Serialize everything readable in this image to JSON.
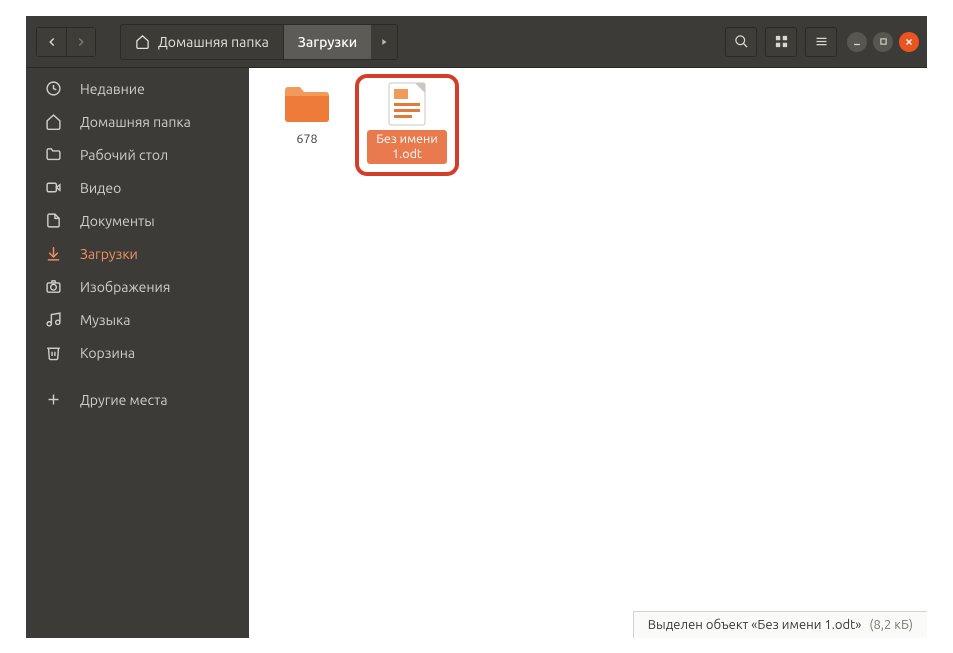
{
  "pathbar": {
    "home_label": "Домашняя папка",
    "current": "Загрузки"
  },
  "sidebar": {
    "items": [
      {
        "label": "Недавние",
        "icon": "clock",
        "active": false
      },
      {
        "label": "Домашняя папка",
        "icon": "home",
        "active": false
      },
      {
        "label": "Рабочий стол",
        "icon": "folder",
        "active": false
      },
      {
        "label": "Видео",
        "icon": "video",
        "active": false
      },
      {
        "label": "Документы",
        "icon": "doc",
        "active": false
      },
      {
        "label": "Загрузки",
        "icon": "download",
        "active": true
      },
      {
        "label": "Изображения",
        "icon": "camera",
        "active": false
      },
      {
        "label": "Музыка",
        "icon": "music",
        "active": false
      },
      {
        "label": "Корзина",
        "icon": "trash",
        "active": false
      }
    ],
    "other_places": "Другие места"
  },
  "files": [
    {
      "name": "678",
      "type": "folder",
      "selected": false
    },
    {
      "name": "Без имени 1.odt",
      "type": "document",
      "selected": true
    }
  ],
  "status": {
    "text": "Выделен объект «Без имени 1.odt»",
    "size": "(8,2 кБ)"
  },
  "colors": {
    "accent": "#e95420",
    "sidebar_bg": "#3c3b37",
    "selected_label_bg": "#e87a4d"
  }
}
